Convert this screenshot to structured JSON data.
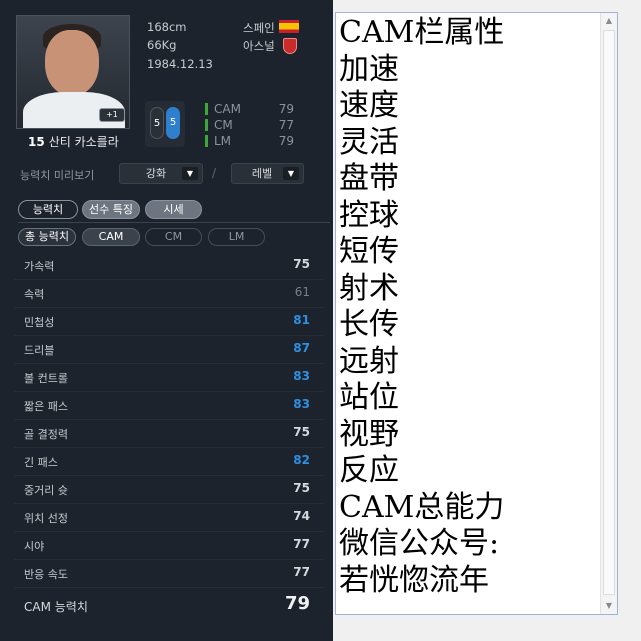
{
  "player": {
    "height": "168cm",
    "weight": "66Kg",
    "birth": "1984.12.13",
    "nation": "스페인",
    "club": "아스널",
    "number": "15",
    "name": "산티 카소를라",
    "grade_badge": "+1",
    "weak_foot_left": "5",
    "weak_foot_right": "5",
    "flag_colors": [
      "#c8202a",
      "#f5c400"
    ]
  },
  "positions": [
    {
      "name": "CAM",
      "value": "79"
    },
    {
      "name": "CM",
      "value": "77"
    },
    {
      "name": "LM",
      "value": "79"
    }
  ],
  "preview": {
    "label": "능력치 미리보기",
    "enhance": "강화",
    "level": "레벨",
    "separator": "/"
  },
  "tabs": [
    "능력치",
    "선수 특징",
    "시세"
  ],
  "segments": {
    "total": "총 능력치",
    "options": [
      "CAM",
      "CM",
      "LM"
    ]
  },
  "stats": [
    {
      "name": "가속력",
      "value": "75",
      "color": "normal"
    },
    {
      "name": "속력",
      "value": "61",
      "color": "dim"
    },
    {
      "name": "민첩성",
      "value": "81",
      "color": "blue"
    },
    {
      "name": "드리블",
      "value": "87",
      "color": "blue"
    },
    {
      "name": "볼 컨트롤",
      "value": "83",
      "color": "blue"
    },
    {
      "name": "짧은 패스",
      "value": "83",
      "color": "blue"
    },
    {
      "name": "골 결정력",
      "value": "75",
      "color": "normal"
    },
    {
      "name": "긴 패스",
      "value": "82",
      "color": "blue"
    },
    {
      "name": "중거리 슛",
      "value": "75",
      "color": "normal"
    },
    {
      "name": "위치 선정",
      "value": "74",
      "color": "normal"
    },
    {
      "name": "시야",
      "value": "77",
      "color": "normal"
    },
    {
      "name": "반응 속도",
      "value": "77",
      "color": "normal"
    }
  ],
  "total_row": {
    "name": "CAM 능력치",
    "value": "79"
  },
  "note_lines": [
    "CAM栏属性",
    "加速",
    "速度",
    "灵活",
    "盘带",
    "控球",
    "短传",
    "射术",
    "长传",
    "远射",
    "站位",
    "视野",
    "反应",
    "CAM总能力",
    "微信公众号:",
    "若恍惚流年"
  ],
  "icons": {
    "dropdown": "▼",
    "scroll_up": "▲",
    "scroll_down": "▼"
  },
  "colors": {
    "panel_bg": "#1d232c",
    "stat_blue": "#2f8fe0",
    "position_bar": "#3fa63a"
  }
}
